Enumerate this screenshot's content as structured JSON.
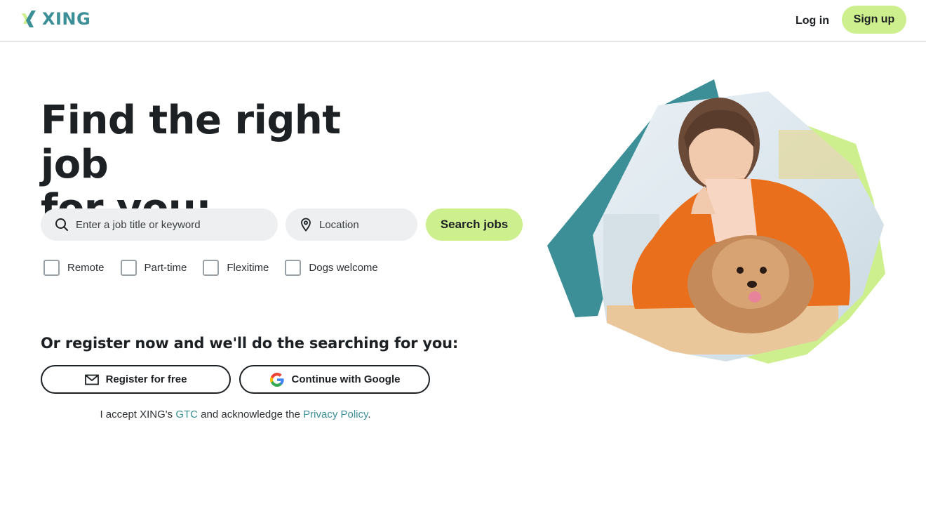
{
  "brand": {
    "name": "XING",
    "color": "#3c8f97",
    "accent": "#ceef8e"
  },
  "header": {
    "login_label": "Log in",
    "signup_label": "Sign up"
  },
  "hero": {
    "headline_line1": "Find the right job",
    "headline_line2": "for you:",
    "image_icon": "photo-woman-with-dog"
  },
  "search": {
    "keyword_placeholder": "Enter a job title or keyword",
    "keyword_value": "",
    "location_placeholder": "Location",
    "location_value": "",
    "button_label": "Search jobs"
  },
  "filters": [
    {
      "label": "Remote",
      "checked": false
    },
    {
      "label": "Part-time",
      "checked": false
    },
    {
      "label": "Flexitime",
      "checked": false
    },
    {
      "label": "Dogs welcome",
      "checked": false
    }
  ],
  "register": {
    "title": "Or register now and we'll do the searching for you:",
    "email_button": "Register for free",
    "google_button": "Continue with Google"
  },
  "legal": {
    "prefix": "I accept XING's ",
    "gtc_link": "GTC",
    "middle": " and acknowledge the ",
    "privacy_link": "Privacy Policy",
    "suffix": "."
  }
}
